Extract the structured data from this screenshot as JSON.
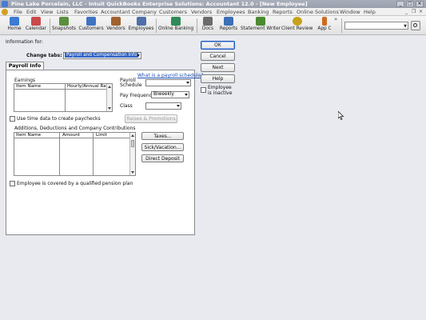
{
  "window": {
    "title": "Pine Lake Porcelain, LLC  - Intuit QuickBooks Enterprise Solutions: Accountant 12.0 - [New Employee]"
  },
  "menu": {
    "items": [
      "File",
      "Edit",
      "View",
      "Lists",
      "Favorites",
      "Accountant",
      "Company",
      "Customers",
      "Vendors",
      "Employees",
      "Banking",
      "Reports",
      "Online Solutions",
      "Window",
      "Help"
    ]
  },
  "toolbar": {
    "items": [
      {
        "label": "Home",
        "icon": "home-icon",
        "color": "#3a7bd5"
      },
      {
        "label": "Calendar",
        "icon": "calendar-icon",
        "color": "#c94a4a"
      },
      {
        "label": "Snapshots",
        "icon": "snapshots-icon",
        "color": "#5a8f3c"
      },
      {
        "label": "Customers",
        "icon": "customers-icon",
        "color": "#3f73c4"
      },
      {
        "label": "Vendors",
        "icon": "vendors-icon",
        "color": "#a0622d"
      },
      {
        "label": "Employees",
        "icon": "employees-icon",
        "color": "#4f6fa8"
      },
      {
        "label": "Online Banking",
        "icon": "online-banking-icon",
        "color": "#2e8b57"
      },
      {
        "label": "Docs",
        "icon": "docs-icon",
        "color": "#6b6b6b"
      },
      {
        "label": "Reports",
        "icon": "reports-icon",
        "color": "#3b6fb6"
      },
      {
        "label": "Statement Writer",
        "icon": "statement-writer-icon",
        "color": "#4b8a2f"
      },
      {
        "label": "Client Review",
        "icon": "client-review-icon",
        "color": "#c7a21a"
      },
      {
        "label": "App C",
        "icon": "app-center-icon",
        "color": "#d06a1e"
      }
    ],
    "more_label": "»"
  },
  "dialog": {
    "info_for_label": "Information for:",
    "change_tabs_label": "Change tabs:",
    "change_tabs_value": "Payroll and Compensation Info",
    "tab_label": "Payroll Info",
    "what_is_link": "What is a payroll schedule?",
    "earnings_label": "Earnings",
    "earnings_columns": [
      "Item Name",
      "Hourly/Annual Rate"
    ],
    "payroll_schedule_label": "Payroll Schedule",
    "pay_frequency_label": "Pay Frequency",
    "pay_frequency_value": "Biweekly",
    "class_label": "Class",
    "raises_button": "Raises & Promotions",
    "use_time_data_label": "Use time data to create paychecks",
    "additions_label": "Additions, Deductions and Company Contributions",
    "additions_columns": [
      "Item Name",
      "Amount",
      "Limit"
    ],
    "taxes_button": "Taxes...",
    "sick_button": "Sick/Vacation...",
    "direct_deposit_button": "Direct Deposit",
    "pension_label": "Employee is covered by a qualified pension plan",
    "ok_button": "OK",
    "cancel_button": "Cancel",
    "next_button": "Next",
    "help_button": "Help",
    "inactive_label": "Employee is inactive"
  }
}
